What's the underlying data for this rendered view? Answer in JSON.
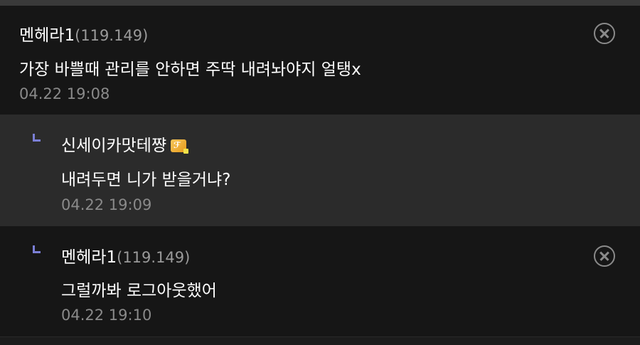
{
  "comments": [
    {
      "nickname": "멘헤라1",
      "ip": "(119.149)",
      "text": "가장 바쁠때 관리를 안하면 주딱 내려놔야지 얼탱x",
      "date": "04.22 19:08",
      "is_reply": false,
      "deletable": true
    },
    {
      "nickname": "신세이카맛테쨩",
      "ip": "",
      "badge_icon": "gallery-badge-icon",
      "text": "내려두면 니가 받을거냐?",
      "date": "04.22 19:09",
      "is_reply": true,
      "deletable": false
    },
    {
      "nickname": "멘헤라1",
      "ip": "(119.149)",
      "text": "그럴까봐 로그아웃했어",
      "date": "04.22 19:10",
      "is_reply": true,
      "deletable": true
    }
  ],
  "colors": {
    "background": "#121212",
    "reply_highlight": "#2b2b2b",
    "reply_marker": "#7b7fd6",
    "date_text": "#8a8a8a"
  }
}
